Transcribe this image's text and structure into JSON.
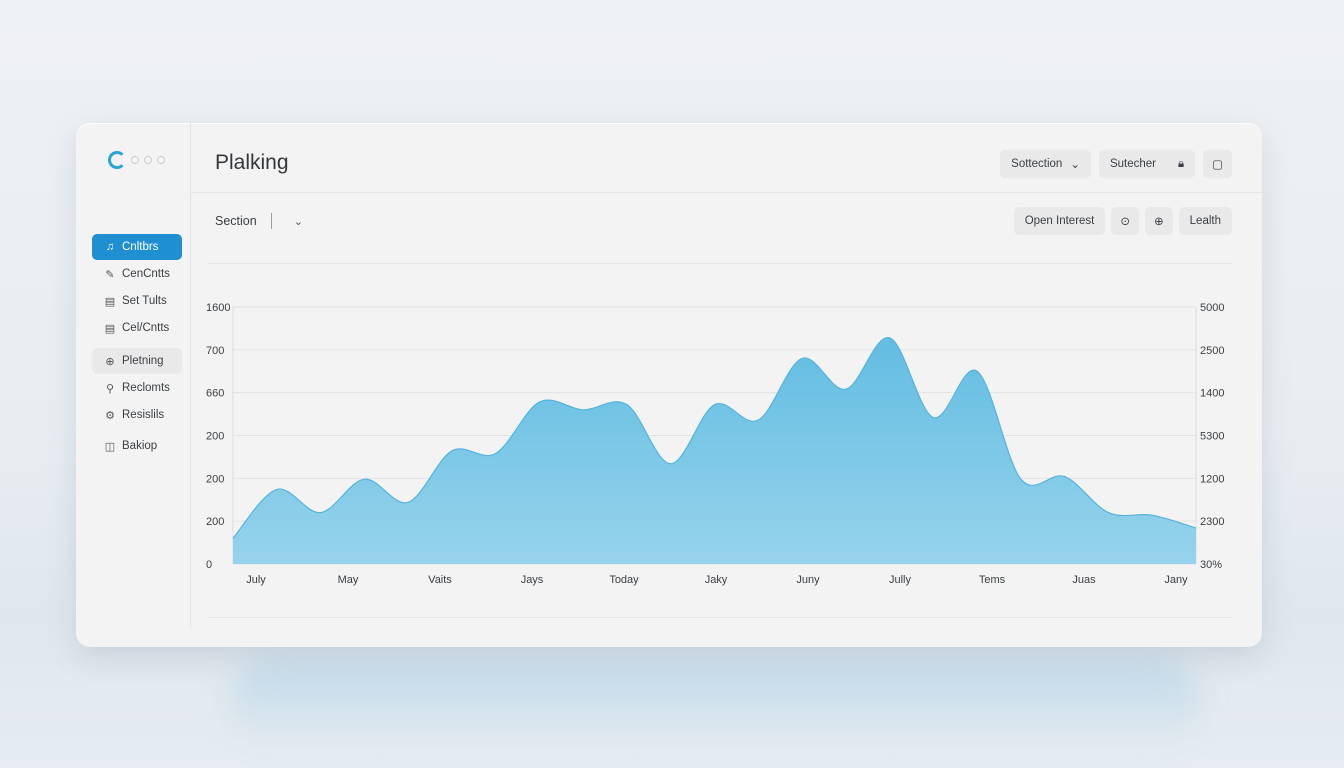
{
  "window": {
    "title": "Plalking",
    "top_buttons": [
      {
        "label": "Sottection",
        "icon": "chevron-down-icon"
      },
      {
        "label": "Sutecher",
        "icon": "lock-icon"
      }
    ],
    "square_icon": "square-icon"
  },
  "sidebar": {
    "items": [
      {
        "label": "Cnltbrs",
        "icon": "music-note-icon",
        "state": "active"
      },
      {
        "label": "CenCntts",
        "icon": "pencil-icon"
      },
      {
        "label": "Set Tults",
        "icon": "document-icon"
      },
      {
        "label": "Cel/Cntts",
        "icon": "document-icon"
      },
      {
        "label": "Pletning",
        "icon": "globe-icon",
        "state": "highlighted"
      },
      {
        "label": "Reclomts",
        "icon": "key-icon"
      },
      {
        "label": "Resislils",
        "icon": "settings-icon"
      },
      {
        "label": "Bakiop",
        "icon": "chart-icon"
      }
    ]
  },
  "toolbar": {
    "section_label": "Section",
    "open_interest_label": "Open Interest",
    "lealth_label": "Lealth"
  },
  "chart_data": {
    "type": "area",
    "x": [
      "July",
      "May",
      "Vaits",
      "Jays",
      "Today",
      "Jaky",
      "Juny",
      "Jully",
      "Tems",
      "Juas",
      "Jany"
    ],
    "y_left_ticks": [
      "0",
      "200",
      "200",
      "200",
      "660",
      "700",
      "1600"
    ],
    "y_right_ticks": [
      "30%",
      "2300",
      "1200",
      "5300",
      "1400",
      "2500",
      "5000"
    ],
    "values": [
      0.1,
      0.29,
      0.2,
      0.33,
      0.24,
      0.44,
      0.43,
      0.63,
      0.6,
      0.62,
      0.39,
      0.62,
      0.56,
      0.8,
      0.68,
      0.88,
      0.57,
      0.75,
      0.33,
      0.34,
      0.2,
      0.19,
      0.14
    ],
    "color": "#7ec8e8",
    "grid": true
  }
}
